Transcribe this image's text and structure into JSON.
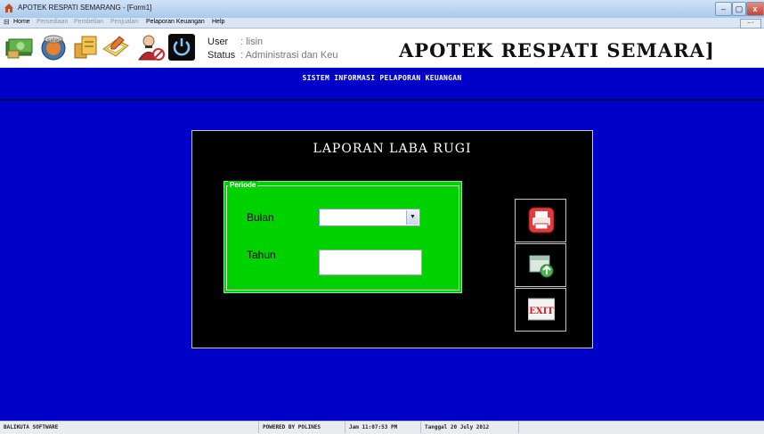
{
  "window": {
    "title": "APOTEK RESPATI SEMARANG - [Form1]",
    "controls": [
      "–",
      "▢",
      "x"
    ]
  },
  "menu": {
    "items": [
      {
        "label": "Home",
        "state": "active"
      },
      {
        "label": "Persediaan",
        "state": "dim"
      },
      {
        "label": "Pembelian",
        "state": "dim"
      },
      {
        "label": "Penjualan",
        "state": "dim"
      },
      {
        "label": "Pelaporan Keuangan",
        "state": "active"
      },
      {
        "label": "Help",
        "state": "active"
      }
    ],
    "mdi_controls": "– ▫"
  },
  "toolbar": {
    "icons": [
      "money-icon",
      "sales-icon",
      "documents-icon",
      "notebook-icon",
      "user-delete-icon",
      "power-icon"
    ]
  },
  "user_info": {
    "user_label": "User",
    "user_value": ": lisin",
    "status_label": "Status",
    "status_value": ": Administrasi dan Keu"
  },
  "brand": "APOTEK RESPATI SEMARA]",
  "subtitle": "SISTEM INFORMASI PELAPORAN KEUANGAN",
  "report": {
    "title": "LAPORAN LABA RUGI",
    "group_label": "Periode",
    "bulan_label": "Bulan",
    "tahun_label": "Tahun",
    "bulan_value": "",
    "tahun_value": ""
  },
  "actions": {
    "buttons": [
      "print-icon",
      "export-icon",
      "exit-icon"
    ],
    "exit_text": "EXIT"
  },
  "colors": {
    "background": "#0000c8",
    "panel": "#000000",
    "group": "#00d200"
  },
  "statusbar": {
    "software": "BALIKUTA SOFTWARE",
    "powered": "POWERED BY POLINES",
    "time": "Jam  11:07:53 PM",
    "date": "Tanggal 20 July 2012"
  }
}
